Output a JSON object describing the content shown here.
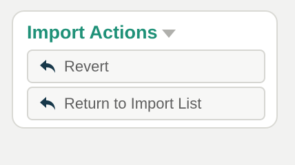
{
  "panel": {
    "title": "Import Actions",
    "toggle_icon": "caret-down-icon",
    "title_color": "#1f9178"
  },
  "actions": [
    {
      "label": "Revert",
      "icon": "undo-arrow-icon"
    },
    {
      "label": "Return to Import List",
      "icon": "undo-arrow-icon"
    }
  ],
  "colors": {
    "icon": "#17384a",
    "label": "#5f5f5f"
  }
}
